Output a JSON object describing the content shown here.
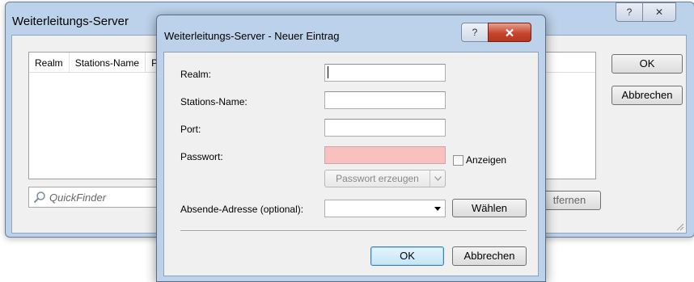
{
  "background_dialog": {
    "title": "Weiterleitungs-Server",
    "help_glyph": "?",
    "close_glyph": "✕",
    "table_headers": [
      "Realm",
      "Stations-Name",
      "P"
    ],
    "quickfinder_placeholder": "QuickFinder",
    "remove_label": "tfernen",
    "ok_label": "OK",
    "cancel_label": "Abbrechen"
  },
  "dialog": {
    "title": "Weiterleitungs-Server - Neuer Eintrag",
    "help_glyph": "?",
    "close_glyph": "✕",
    "fields": {
      "realm_label": "Realm:",
      "realm_value": "",
      "station_label": "Stations-Name:",
      "station_value": "",
      "port_label": "Port:",
      "port_value": "",
      "password_label": "Passwort:",
      "password_value": "",
      "show_label": "Anzeigen",
      "show_checked": false,
      "generate_label": "Passwort erzeugen",
      "sender_label": "Absende-Adresse (optional):",
      "sender_value": "",
      "choose_label": "Wählen"
    },
    "ok_label": "OK",
    "cancel_label": "Abbrechen"
  },
  "colors": {
    "frame": "#bcd2ea",
    "password_invalid": "#f9c0c0",
    "close_button": "#c8452d",
    "default_button_border": "#3c7fb1"
  },
  "icons": {
    "quickfinder": "magnifier-icon",
    "close": "close-icon",
    "help": "help-icon",
    "dropdown": "chevron-down-icon"
  }
}
